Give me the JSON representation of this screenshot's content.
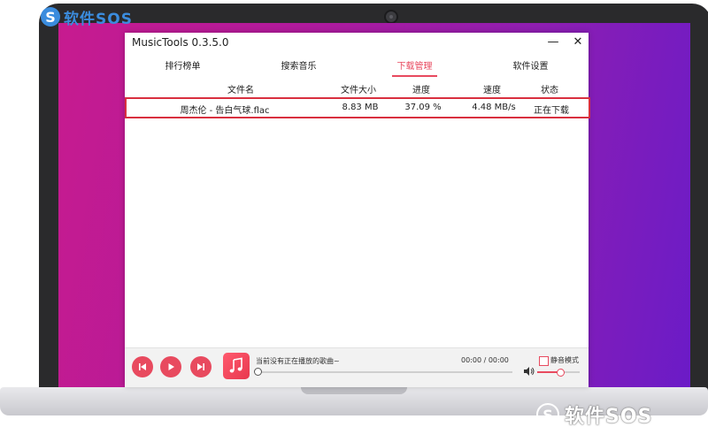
{
  "app": {
    "title": "MusicTools 0.3.5.0",
    "minimize_label": "—",
    "close_label": "✕"
  },
  "tabs": [
    {
      "label": "排行榜单",
      "active": false
    },
    {
      "label": "搜索音乐",
      "active": false
    },
    {
      "label": "下载管理",
      "active": true
    },
    {
      "label": "软件设置",
      "active": false
    }
  ],
  "table": {
    "headers": [
      "文件名",
      "文件大小",
      "进度",
      "速度",
      "状态"
    ],
    "rows": [
      {
        "name": "周杰伦 - 告白气球.flac",
        "size": "8.83 MB",
        "progress": "37.09 %",
        "speed": "4.48 MB/s",
        "status": "正在下载"
      }
    ]
  },
  "player": {
    "now_playing": "当前没有正在播放的歌曲~",
    "time": "00:00 / 00:00",
    "mute_label": "静音模式",
    "mute_checked": false,
    "progress": 0,
    "volume": 0.55
  },
  "watermark": {
    "top": "软件SOS",
    "bottom": "软件SOS"
  },
  "colors": {
    "accent": "#e84a5f",
    "highlight_border": "#d9303f",
    "logo_blue": "#3b8cde"
  },
  "icons": [
    "previous-icon",
    "play-icon",
    "next-icon",
    "music-note-icon",
    "volume-icon"
  ]
}
